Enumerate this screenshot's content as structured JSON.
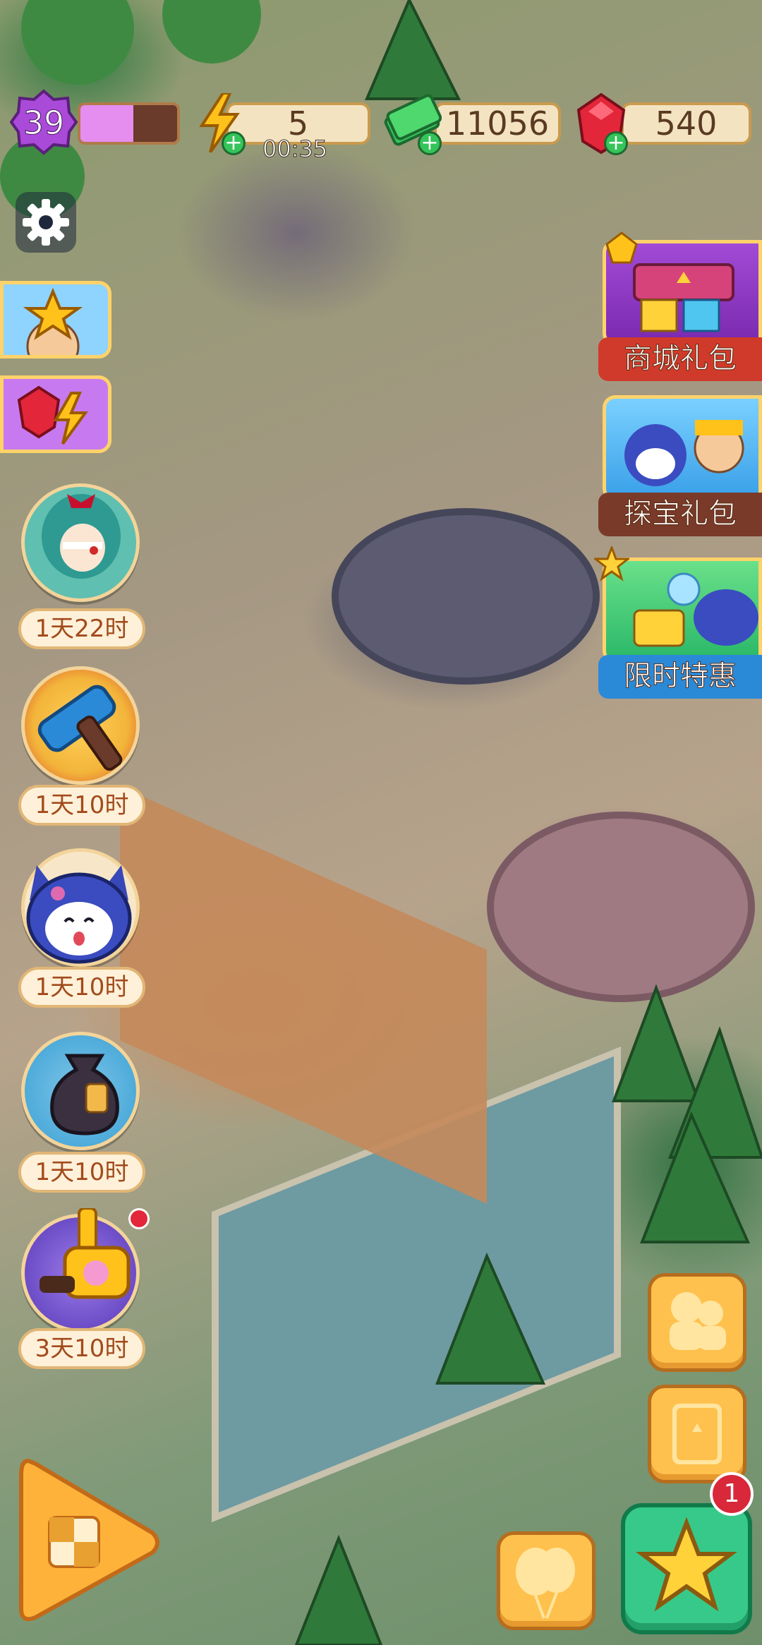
{
  "hud": {
    "level": "39",
    "level_progress": 0.55,
    "energy_value": "5",
    "energy_timer": "00:35",
    "cash_value": "11056",
    "gem_value": "540"
  },
  "side_packs": [
    {
      "label": "商城礼包"
    },
    {
      "label": "探宝礼包"
    },
    {
      "label": "限时特惠"
    }
  ],
  "event_timers": [
    {
      "timer": "1天22时"
    },
    {
      "timer": "1天10时"
    },
    {
      "timer": "1天10时"
    },
    {
      "timer": "1天10时"
    },
    {
      "timer": "3天10时"
    }
  ],
  "bottom": {
    "notification_count": "1"
  },
  "colors": {
    "accent_orange": "#ffb23a",
    "gem_red": "#e3263a",
    "cash_green": "#38c45a",
    "level_purple": "#a94bd8",
    "star_button_green": "#37c98a"
  }
}
